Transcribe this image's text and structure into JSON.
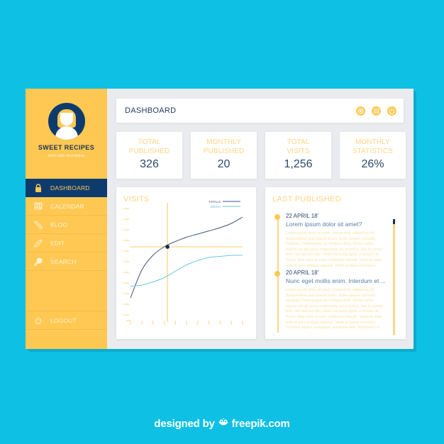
{
  "app": {
    "brand": "SWEET RECIPES",
    "tagline": "short web description"
  },
  "colors": {
    "background": "#0ec0e4",
    "sidebar": "#fec852",
    "navy": "#0d3b6e",
    "accent_light": "#fdd584",
    "line_totals": "#3e5878",
    "line_media": "#6cc7de"
  },
  "sidebar": {
    "items": [
      {
        "label": "DASHBOARD",
        "icon": "lock-icon",
        "active": true
      },
      {
        "label": "CALENDAR",
        "icon": "calendar-icon",
        "active": false
      },
      {
        "label": "BLOG",
        "icon": "pencil-icon",
        "active": false
      },
      {
        "label": "EDIT",
        "icon": "pen-icon",
        "active": false
      },
      {
        "label": "SEARCH",
        "icon": "search-icon",
        "active": false
      }
    ],
    "logout": {
      "label": "LOGOUT",
      "icon": "power-icon"
    }
  },
  "header": {
    "title": "DASHBOARD",
    "icons": [
      "target-icon",
      "menu-icon",
      "power-icon"
    ]
  },
  "stats": [
    {
      "label_line1": "TOTAL",
      "label_line2": "PUBLISHED",
      "value": "326"
    },
    {
      "label_line1": "MONTHLY",
      "label_line2": "PUBLISHED",
      "value": "20"
    },
    {
      "label_line1": "TOTAL",
      "label_line2": "VISITS",
      "value": "1,256"
    },
    {
      "label_line1": "MONTHLY",
      "label_line2": "STATISTICS",
      "value": "26%"
    }
  ],
  "visits": {
    "title": "VISITS"
  },
  "chart_data": {
    "type": "line",
    "title": "VISITS",
    "xlabel": "",
    "ylabel": "",
    "x": [
      0,
      1,
      2,
      3,
      4,
      5,
      6,
      7,
      8,
      9,
      10
    ],
    "ylim": [
      0,
      10
    ],
    "grid": false,
    "legend": "top-right",
    "series": [
      {
        "name": "TOTALS",
        "values": [
          1.6,
          4.2,
          5.6,
          6.4,
          6.9,
          7.3,
          7.6,
          7.9,
          8.2,
          8.6,
          9.2
        ]
      },
      {
        "name": "MEDIA",
        "values": [
          2.7,
          2.8,
          3.1,
          3.5,
          4.1,
          4.7,
          5.1,
          5.4,
          5.5,
          5.6,
          5.6
        ]
      }
    ],
    "highlight_point": {
      "series": "TOTALS",
      "x": 3.3,
      "y": 6.4
    },
    "crosshair": {
      "x": 3.3,
      "y": 6.4
    }
  },
  "last_published": {
    "title": "LAST PUBLISHED",
    "posts": [
      {
        "date": "22 APRIL 18'",
        "title": "Lorem ipsum dolor sit amet?",
        "body": "Lorem ipsum dolor sit amet, consectetur adipiscing elit. Suspendisse quis blandit lorem. Nulla congue convallis tincidunt. Pellentesque ac tristique dolor. Donec luctus mauris vel elit luctus malesuada vel et lectus. Sed in cursus felis, non laoreet odio. Etiam vel porta ligula, a tempor mi. Fusce vitae nunc at nunc vestibulum blandit. Vivamus vitae ante et arcu tristique egestas. Morbi at ipsum maximus, hendrerit sapien consequat, venenatis felis. Vestibulum id hendrerit felis."
      },
      {
        "date": "20 APRIL 18'",
        "title": "Nunc eget mollis enim. Interdum et ...",
        "body": "Lorem ipsum dolor sit amet, consectetur adipiscing elit. Suspendisse quis blandit lorem. Nulla congue convallis tincidunt. Pellentesque ac tristique dolor. Donec luctus mauris vel elit luctus malesuada vel et lectus. Sed in cursus felis, non laoreet odio. Etiam vel porta ligula, a tempor mi. Fusce vitae nunc at nunc vestibulum blandit. Vivamus vitae ante et arcu tristique egestas. Morbi at ipsum maximus, hendrerit sapien consequat, venenatis felis. Vestibulum id hendrerit felis."
      }
    ],
    "scroll_position": 0
  },
  "footer": {
    "credit_prefix": "designed by",
    "credit_brand": "freepik.com"
  }
}
